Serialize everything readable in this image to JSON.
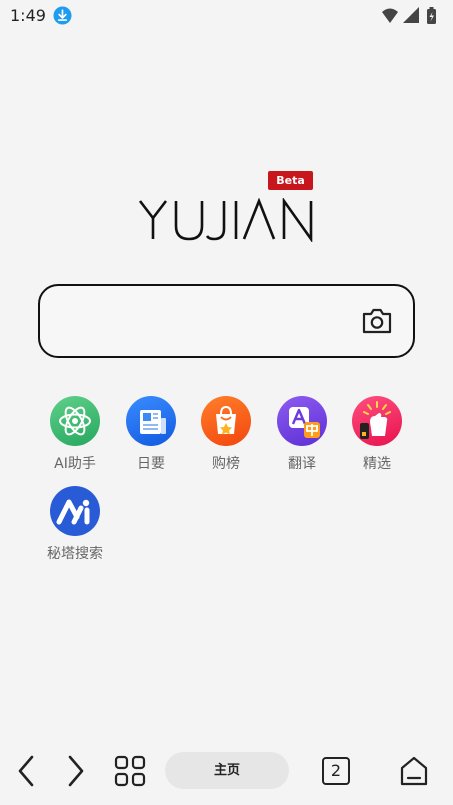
{
  "status_bar": {
    "time": "1:49",
    "download_icon": "download-arrow-icon",
    "wifi_icon": "wifi-icon",
    "signal_icon": "signal-icon",
    "battery_icon": "battery-charging-icon"
  },
  "logo": {
    "text": "YUJIAN",
    "badge": "Beta",
    "badge_color": "#c8161d"
  },
  "search": {
    "placeholder": "",
    "camera_icon": "camera-icon"
  },
  "shortcuts": [
    {
      "label": "AI助手",
      "icon": "atom-icon",
      "color": "#3bb36a"
    },
    {
      "label": "日要",
      "icon": "newspaper-icon",
      "color": "#1e6ff0"
    },
    {
      "label": "购榜",
      "icon": "shopping-bag-star-icon",
      "color": "#ff6a1a"
    },
    {
      "label": "翻译",
      "icon": "translate-icon",
      "color": "#7b4be0"
    },
    {
      "label": "精选",
      "icon": "thumbs-up-icon",
      "color": "#f0266a"
    },
    {
      "label": "秘塔搜索",
      "icon": "metaso-icon",
      "color": "#2a5bd7"
    }
  ],
  "bottom_nav": {
    "back_icon": "back-arrow-icon",
    "forward_icon": "forward-arrow-icon",
    "apps_icon": "grid-icon",
    "home_label": "主页",
    "tab_count": "2",
    "profile_icon": "home-profile-icon"
  }
}
